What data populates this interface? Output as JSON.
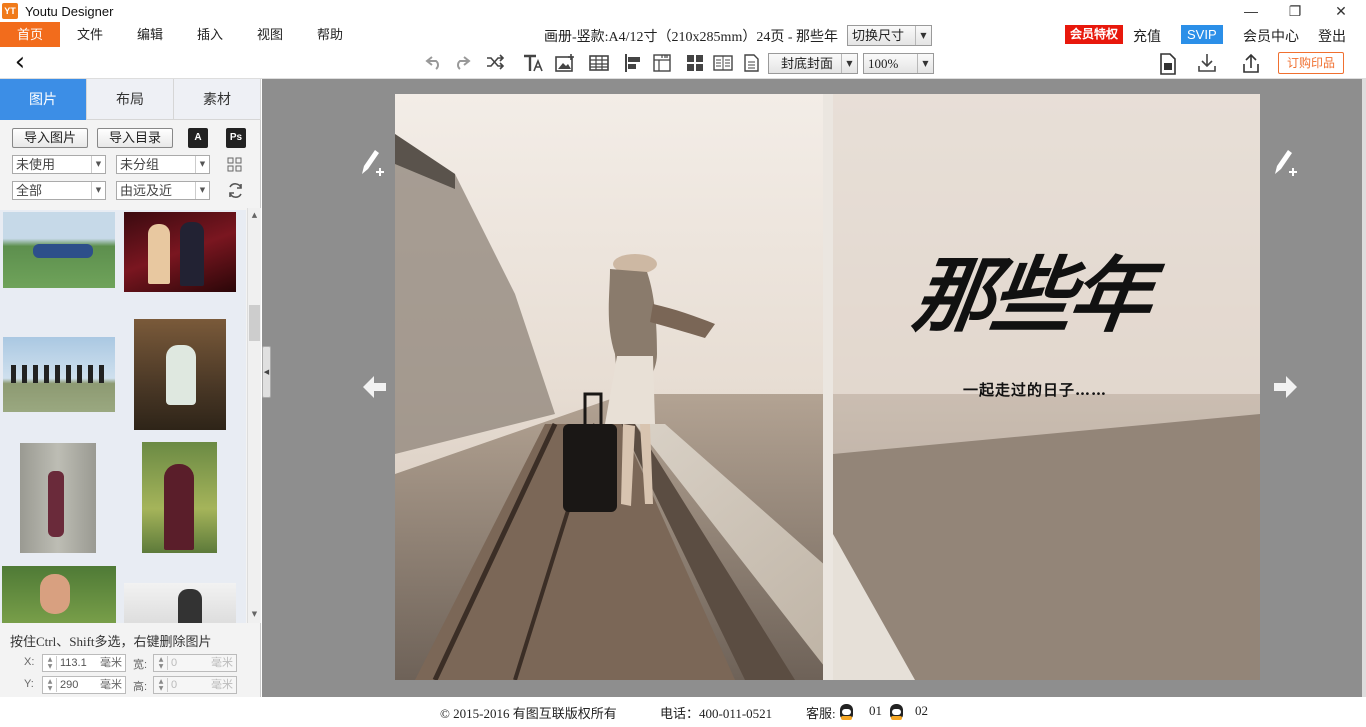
{
  "window": {
    "title": "Youtu Designer",
    "logo_text": "YT",
    "min_icon": "—",
    "max_icon": "❐",
    "close_icon": "✕"
  },
  "menu": {
    "items": [
      {
        "label": "首页",
        "active": true
      },
      {
        "label": "文件"
      },
      {
        "label": "编辑"
      },
      {
        "label": "插入"
      },
      {
        "label": "视图"
      },
      {
        "label": "帮助"
      }
    ],
    "doc_info": "画册-竖款:A4/12寸（210x285mm）24页 - 那些年",
    "size_switch": "切换尺寸",
    "member_badge": "会员特权",
    "recharge": "充值",
    "svip": "SVIP",
    "member_center": "会员中心",
    "logout": "登出"
  },
  "toolbar": {
    "page_select": "封底封面",
    "zoom": "100%",
    "order_print": "订购印品",
    "back_icon": "‹"
  },
  "sidebar": {
    "tabs": [
      {
        "label": "图片",
        "active": true
      },
      {
        "label": "布局"
      },
      {
        "label": "素材"
      }
    ],
    "import_photos": "导入图片",
    "import_folder": "导入目录",
    "pdf_icon_text": "A",
    "ps_icon_text": "Ps",
    "filter_usage": "未使用",
    "filter_group": "未分组",
    "filter_range": "全部",
    "sort_order": "由远及近",
    "hint": "按住Ctrl、Shift多选，右键删除图片",
    "x_label": "X:",
    "x_value": "113.1",
    "y_label": "Y:",
    "y_value": "290",
    "w_label": "宽:",
    "w_value": "0",
    "h_label": "高:",
    "h_value": "0",
    "unit": "毫米"
  },
  "cover": {
    "title": "那些年",
    "subtitle": "一起走过的日子……"
  },
  "footer": {
    "copyright": "© 2015-2016 有图互联版权所有",
    "phone": "电话：400-011-0521",
    "service_label": "客服:",
    "service_1": "01",
    "service_2": "02"
  },
  "colors": {
    "accent": "#f26c1c",
    "tab_active": "#3c8ee6",
    "badge_red": "#e8180c",
    "svip_blue": "#2b8fe8"
  }
}
